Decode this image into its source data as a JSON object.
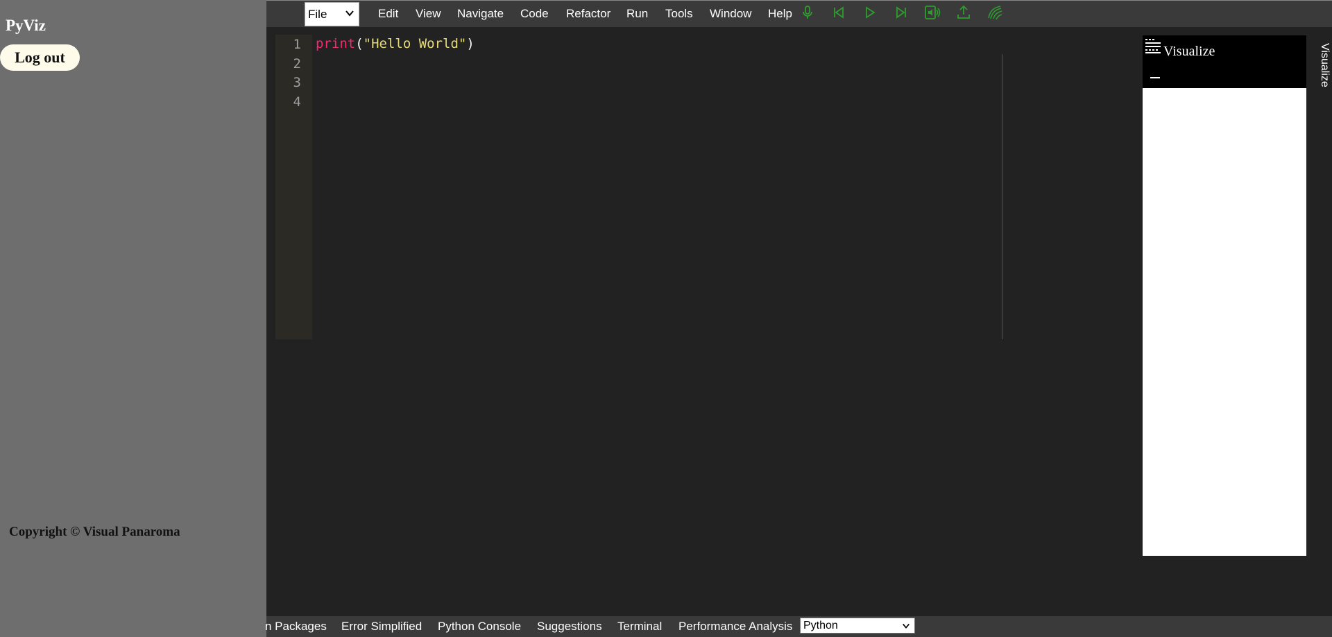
{
  "sidebar": {
    "app_title": "PyViz",
    "logout_label": "Log out",
    "copyright": "Copyright © Visual Panaroma"
  },
  "menubar": {
    "file_select_value": "File",
    "items": [
      "Edit",
      "View",
      "Navigate",
      "Code",
      "Refactor",
      "Run",
      "Tools",
      "Window",
      "Help"
    ],
    "toolbar_icons": [
      "microphone-icon",
      "skip-back-icon",
      "play-icon",
      "skip-forward-icon",
      "speaker-icon",
      "upload-icon",
      "wave-icon"
    ],
    "icon_color": "#2e9d2e"
  },
  "editor": {
    "line_numbers": [
      "1",
      "2",
      "3",
      "4"
    ],
    "code": {
      "keyword": "print",
      "open_paren": "(",
      "string": "\"Hello World\"",
      "close_paren": ")"
    }
  },
  "visualize": {
    "title": "Visualize",
    "side_tab_label": "Visualize"
  },
  "bottom_tabs": {
    "items": [
      "n Packages",
      "Error Simplified",
      "Python Console",
      "Suggestions",
      "Terminal",
      "Performance Analysis"
    ],
    "language_select_value": "Python"
  }
}
